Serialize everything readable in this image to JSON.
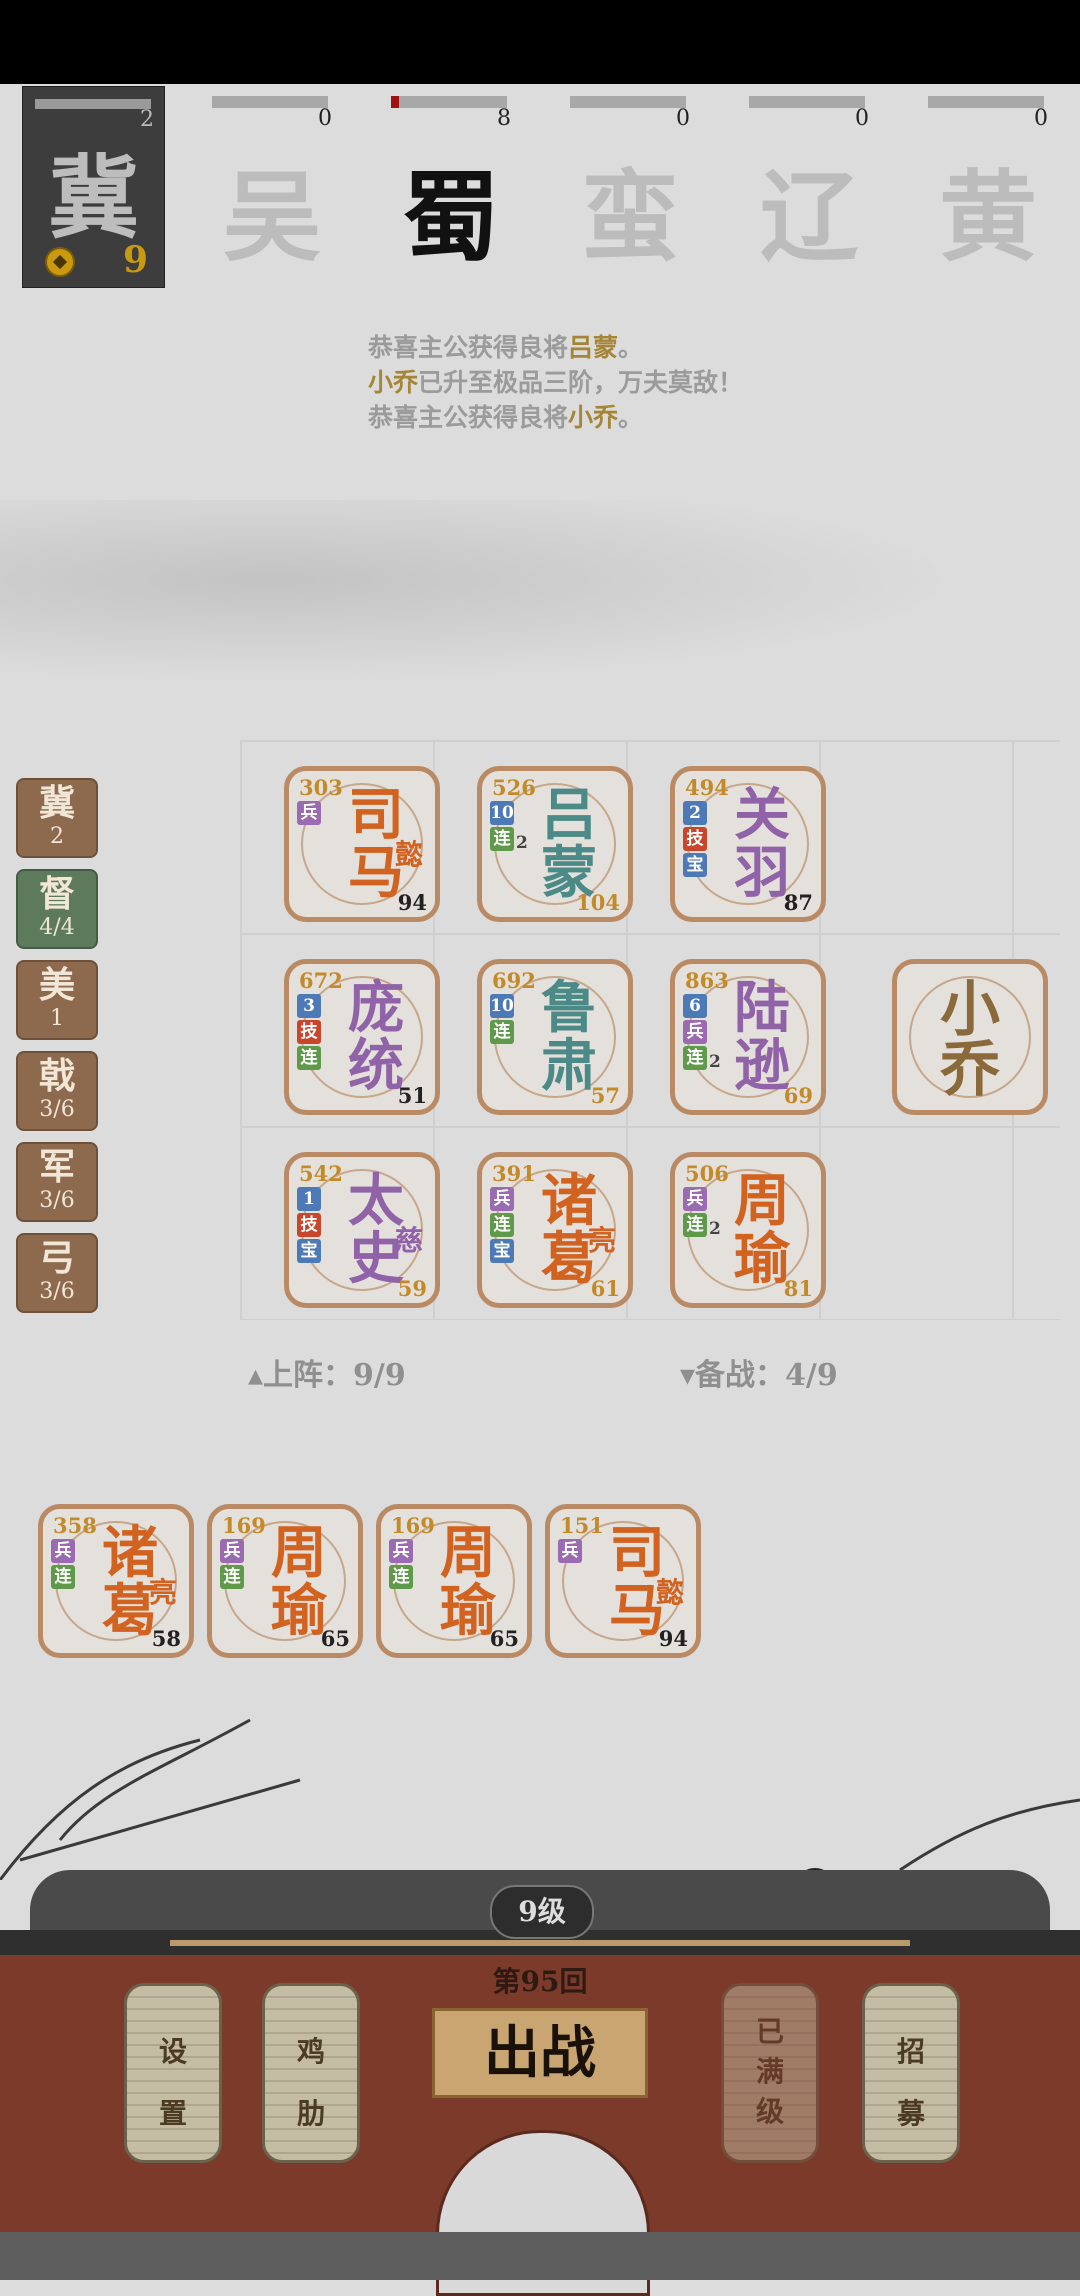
{
  "player_faction": {
    "name": "冀",
    "count": "2",
    "gold": "9"
  },
  "factions": [
    {
      "name": "吴",
      "count": "0",
      "fill": 0
    },
    {
      "name": "蜀",
      "count": "8",
      "fill": 0.07
    },
    {
      "name": "蛮",
      "count": "0",
      "fill": 0
    },
    {
      "name": "辽",
      "count": "0",
      "fill": 0
    },
    {
      "name": "黄",
      "count": "0",
      "fill": 0
    }
  ],
  "messages": [
    {
      "pre": "恭喜主公获得良将",
      "name": "吕蒙",
      "post": "。"
    },
    {
      "pre": "",
      "name": "小乔",
      "post": "已升至极品三阶，万夫莫敌！"
    },
    {
      "pre": "恭喜主公获得良将",
      "name": "小乔",
      "post": "。"
    }
  ],
  "side_tags": [
    {
      "name": "冀",
      "value": "2"
    },
    {
      "name": "督",
      "value": "4/4"
    },
    {
      "name": "美",
      "value": "1"
    },
    {
      "name": "戟",
      "value": "3/6"
    },
    {
      "name": "军",
      "value": "3/6"
    },
    {
      "name": "弓",
      "value": "3/6"
    }
  ],
  "board": [
    {
      "power": "303",
      "c1": "司",
      "c2": "马",
      "suffix": "懿",
      "level": "94",
      "badges": [
        "兵"
      ]
    },
    {
      "power": "526",
      "c1": "吕",
      "c2": "蒙",
      "suffix": "",
      "level": "104",
      "badges": [
        "10",
        "连"
      ],
      "extra": "2"
    },
    {
      "power": "494",
      "c1": "关",
      "c2": "羽",
      "suffix": "",
      "level": "87",
      "badges": [
        "2",
        "技",
        "宝"
      ]
    },
    {
      "power": "672",
      "c1": "庞",
      "c2": "统",
      "suffix": "",
      "level": "51",
      "badges": [
        "3",
        "技",
        "连"
      ]
    },
    {
      "power": "692",
      "c1": "鲁",
      "c2": "肃",
      "suffix": "",
      "level": "57",
      "badges": [
        "10",
        "连"
      ]
    },
    {
      "power": "863",
      "c1": "陆",
      "c2": "逊",
      "suffix": "",
      "level": "69",
      "badges": [
        "6",
        "兵",
        "连"
      ],
      "extra": "2"
    },
    {
      "power": "542",
      "c1": "太",
      "c2": "史",
      "suffix": "慈",
      "level": "59",
      "badges": [
        "1",
        "技",
        "宝"
      ]
    },
    {
      "power": "391",
      "c1": "诸",
      "c2": "葛",
      "suffix": "亮",
      "level": "61",
      "badges": [
        "兵",
        "连",
        "宝"
      ]
    },
    {
      "power": "506",
      "c1": "周",
      "c2": "瑜",
      "suffix": "",
      "level": "81",
      "badges": [
        "兵",
        "连"
      ],
      "extra": "2"
    }
  ],
  "special_card": {
    "c1": "小",
    "c2": "乔"
  },
  "status": {
    "deployed": "▴上阵：9/9",
    "reserve": "▾备战：4/9"
  },
  "bench": [
    {
      "power": "358",
      "c1": "诸",
      "c2": "葛",
      "suffix": "亮",
      "level": "58",
      "badges": [
        "兵",
        "连"
      ]
    },
    {
      "power": "169",
      "c1": "周",
      "c2": "瑜",
      "suffix": "",
      "level": "65",
      "badges": [
        "兵",
        "连"
      ]
    },
    {
      "power": "169",
      "c1": "周",
      "c2": "瑜",
      "suffix": "",
      "level": "65",
      "badges": [
        "兵",
        "连"
      ]
    },
    {
      "power": "151",
      "c1": "司",
      "c2": "马",
      "suffix": "懿",
      "level": "94",
      "badges": [
        "兵"
      ]
    }
  ],
  "bottom": {
    "level": "9级",
    "round": "第95回",
    "fight": "出战",
    "settings": [
      "设",
      "置"
    ],
    "chicken": [
      "鸡",
      "肋"
    ],
    "maxed": [
      "已",
      "满",
      "级"
    ],
    "recruit": [
      "招",
      "募"
    ]
  }
}
